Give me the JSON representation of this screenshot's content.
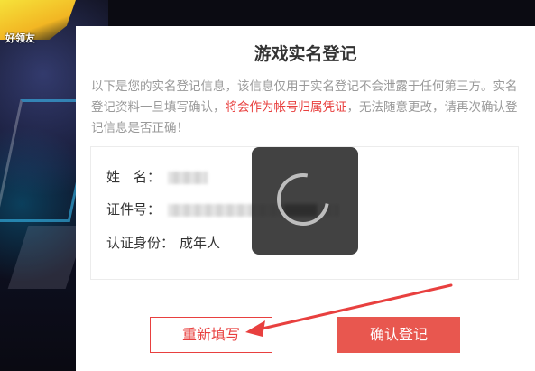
{
  "background": {
    "logo_text": "好领友"
  },
  "dialog": {
    "title": "游戏实名登记",
    "notice_before": "以下是您的实名登记信息，该信息仅用于实名登记不会泄露于任何第三方。实名登记资料一旦填写确认，",
    "notice_warning": "将会作为帐号归属凭证",
    "notice_after": "，无法随意更改，请再次确认登记信息是否正确！",
    "fields": {
      "name_label": "姓　名：",
      "id_label": "证件号：",
      "identity_label": "认证身份：",
      "identity_value": "成年人"
    },
    "buttons": {
      "refill": "重新填写",
      "confirm": "确认登记"
    }
  },
  "colors": {
    "accent_red": "#e8403f",
    "confirm_bg": "#e8574f",
    "notice_gray": "#999999"
  },
  "icons": {
    "loading": "loading-spinner-icon",
    "annotation": "red-arrow-annotation"
  }
}
